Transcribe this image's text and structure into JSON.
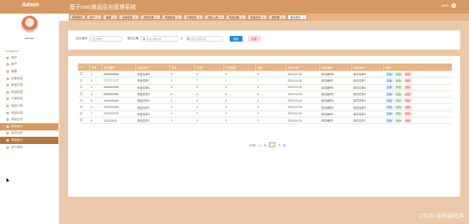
{
  "app": {
    "brand": "Admin",
    "system_title": "基于mvc商品后台管理系统",
    "user": "admin"
  },
  "tabs": [
    {
      "label": "系统首页",
      "closable": false
    },
    {
      "label": "用户",
      "closable": true
    },
    {
      "label": "客服",
      "closable": true
    },
    {
      "label": "仓库信息",
      "closable": true
    },
    {
      "label": "商品分类",
      "closable": true
    },
    {
      "label": "商品信息",
      "closable": true
    },
    {
      "label": "订单信息",
      "closable": true
    },
    {
      "label": "商品入库",
      "closable": true
    },
    {
      "label": "商品出库",
      "closable": true
    },
    {
      "label": "商品出仓",
      "closable": true
    },
    {
      "label": "退货单",
      "closable": true
    },
    {
      "label": "库存统计",
      "closable": true,
      "active": true
    }
  ],
  "sidebar": {
    "profile_name": "admin",
    "nav_title": "Navigation",
    "items": [
      {
        "label": "首页"
      },
      {
        "label": "用户"
      },
      {
        "label": "客服"
      },
      {
        "label": "仓库信息"
      },
      {
        "label": "商品分类"
      },
      {
        "label": "商品信息"
      },
      {
        "label": "订单信息"
      },
      {
        "label": "商品入库"
      },
      {
        "label": "商品出库"
      },
      {
        "label": "商品出仓"
      },
      {
        "label": "库存统计",
        "state": "highlight"
      },
      {
        "label": "库存分析"
      },
      {
        "label": "库存统计",
        "state": "active"
      },
      {
        "label": "用户资料"
      }
    ]
  },
  "search": {
    "field1_label": "统计编号",
    "field1_placeholder": "统计编号",
    "field2_label": "登记日期",
    "date_start_placeholder": "开始日期时间",
    "date_sep": "至",
    "date_end_placeholder": "结束日期时间",
    "search_button": "搜索",
    "reset_button": "重置"
  },
  "table": {
    "columns": [
      "序号",
      "统计编号",
      "商品名称",
      "库存",
      "进货",
      "已售数量",
      "退货",
      "登记日期",
      "库存编号",
      "库存名称",
      "操作"
    ],
    "rows": [
      [
        "1",
        "8888888888",
        "商品名称8",
        "8",
        "8",
        "8",
        "8",
        "2024-04-26",
        "库存编号8",
        "库存名称8"
      ],
      [
        "2",
        "7777777777",
        "商品名称7",
        "7",
        "7",
        "7",
        "7",
        "2024-04-26",
        "库存编号7",
        "库存名称7"
      ],
      [
        "3",
        "6666666666",
        "商品名称6",
        "6",
        "6",
        "6",
        "6",
        "2024-04-26",
        "库存编号6",
        "库存名称6"
      ],
      [
        "4",
        "5555555555",
        "商品名称5",
        "5",
        "5",
        "5",
        "5",
        "2024-04-26",
        "库存编号5",
        "库存名称5"
      ],
      [
        "5",
        "4444444444",
        "商品名称4",
        "4",
        "4",
        "4",
        "4",
        "2024-04-26",
        "库存编号4",
        "库存名称4"
      ],
      [
        "6",
        "3333333333",
        "商品名称3",
        "3",
        "3",
        "3",
        "3",
        "2024-04-26",
        "库存编号3",
        "库存名称3"
      ],
      [
        "7",
        "2222222222",
        "商品名称2",
        "2",
        "2",
        "2",
        "2",
        "2024-04-26",
        "库存编号2",
        "库存名称2"
      ],
      [
        "8",
        "1111111111",
        "商品名称1",
        "1",
        "1",
        "1",
        "1",
        "2024-04-26",
        "库存编号1",
        "库存名称1"
      ]
    ],
    "actions": {
      "view": "查看",
      "edit": "修改",
      "delete": "删除"
    }
  },
  "pager": {
    "total": "共8条",
    "prev": "上一页",
    "current": "1",
    "next": "下一页"
  },
  "watermark": "CSDN @阿诚程序",
  "colors": {
    "primary": "#d59a63",
    "main_bg": "#ebc8a7",
    "table_header": "#e7b488",
    "search_btn": "#1e88e5"
  }
}
